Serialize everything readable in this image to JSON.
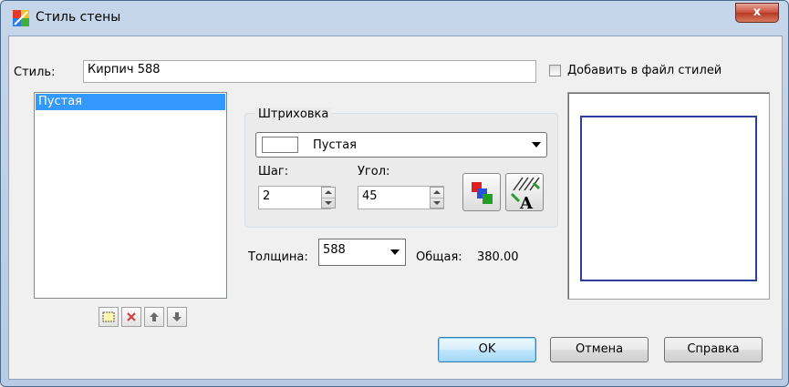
{
  "window": {
    "title": "Стиль стены",
    "close_label": "x"
  },
  "style_row": {
    "label": "Стиль:",
    "value": "Кирпич 588",
    "add_to_file_label": "Добавить в файл стилей",
    "add_to_file_checked": false
  },
  "layers": {
    "items": [
      "Пустая"
    ],
    "selected_index": 0
  },
  "hatch": {
    "group_title": "Штриховка",
    "pattern_selected": "Пустая",
    "step_label": "Шаг:",
    "step_value": "2",
    "angle_label": "Угол:",
    "angle_value": "45"
  },
  "thickness": {
    "label": "Толщина:",
    "value": "588",
    "total_label": "Общая:",
    "total_value": "380.00"
  },
  "buttons": {
    "ok": "OK",
    "cancel": "Отмена",
    "help": "Справка"
  },
  "colors": {
    "selection": "#3399ff",
    "preview_border": "#2d3f9a",
    "close_button": "#c9503c"
  }
}
